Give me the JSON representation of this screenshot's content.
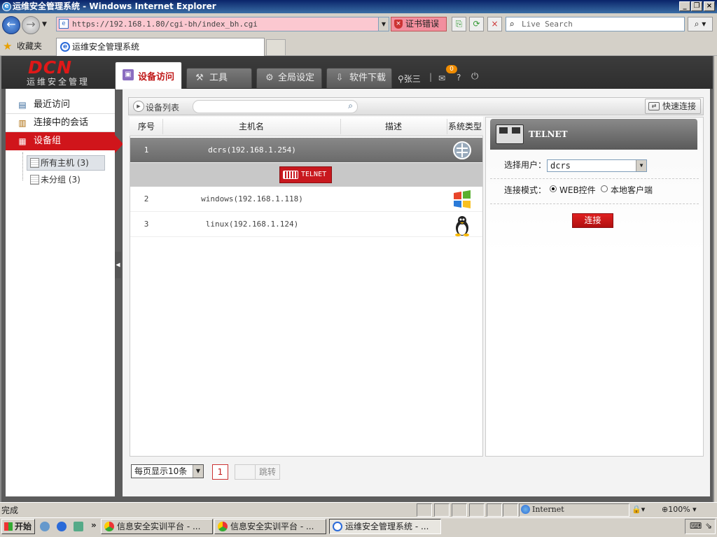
{
  "window": {
    "title": "运维安全管理系统 - Windows Internet Explorer"
  },
  "browser": {
    "address": "https://192.168.1.80/cgi-bh/index_bh.cgi",
    "cert_error": "证书错误",
    "search_placeholder": "Live Search",
    "favorites_label": "收藏夹",
    "tab_title": "运维安全管理系统"
  },
  "app": {
    "logo": "DCN",
    "logo_sub": "运维安全管理",
    "tabs": [
      {
        "label": "设备访问",
        "icon": "monitor-icon",
        "active": true
      },
      {
        "label": "工具",
        "icon": "tools-icon"
      },
      {
        "label": "全局设定",
        "icon": "gear-icon"
      },
      {
        "label": "软件下载",
        "icon": "download-icon"
      }
    ],
    "user": "张三",
    "separator": "|",
    "mail_count": "0",
    "help": "?"
  },
  "sidebar": {
    "items": [
      {
        "label": "最近访问",
        "icon": "recent-icon"
      },
      {
        "label": "连接中的会话",
        "icon": "session-icon"
      },
      {
        "label": "设备组",
        "icon": "server-group-icon",
        "active": true
      }
    ],
    "tree": [
      {
        "label": "所有主机 (3)",
        "selected": true
      },
      {
        "label": "未分组 (3)"
      }
    ]
  },
  "toolbar": {
    "label": "设备列表",
    "quick_connect": "快速连接"
  },
  "table": {
    "headers": [
      "序号",
      "主机名",
      "描述",
      "系统类型"
    ],
    "rows": [
      {
        "seq": "1",
        "host": "dcrs(192.168.1.254)",
        "os": "network-device-icon",
        "selected": true
      },
      {
        "seq": "2",
        "host": "windows(192.168.1.118)",
        "os": "windows-icon"
      },
      {
        "seq": "3",
        "host": "linux(192.168.1.124)",
        "os": "linux-tux-icon"
      }
    ],
    "protocol_button": "TELNET"
  },
  "panel": {
    "title": "TELNET",
    "user_label": "选择用户：",
    "user_value": "dcrs",
    "mode_label": "连接模式：",
    "mode_options": [
      "WEB控件",
      "本地客户端"
    ],
    "mode_selected": "WEB控件",
    "connect": "连接"
  },
  "pager": {
    "per_page": "每页显示10条",
    "page": "1",
    "jump": "跳转"
  },
  "statusbar": {
    "text": "完成",
    "zone": "Internet",
    "zoom": "100%"
  },
  "taskbar": {
    "start": "开始",
    "more": "»",
    "tasks": [
      {
        "label": "信息安全实训平台 - ..."
      },
      {
        "label": "信息安全实训平台 - ..."
      },
      {
        "label": "运维安全管理系统 - ...",
        "active": true
      }
    ]
  },
  "colors": {
    "brand_red": "#d0151b",
    "header_dark": "#333333"
  }
}
